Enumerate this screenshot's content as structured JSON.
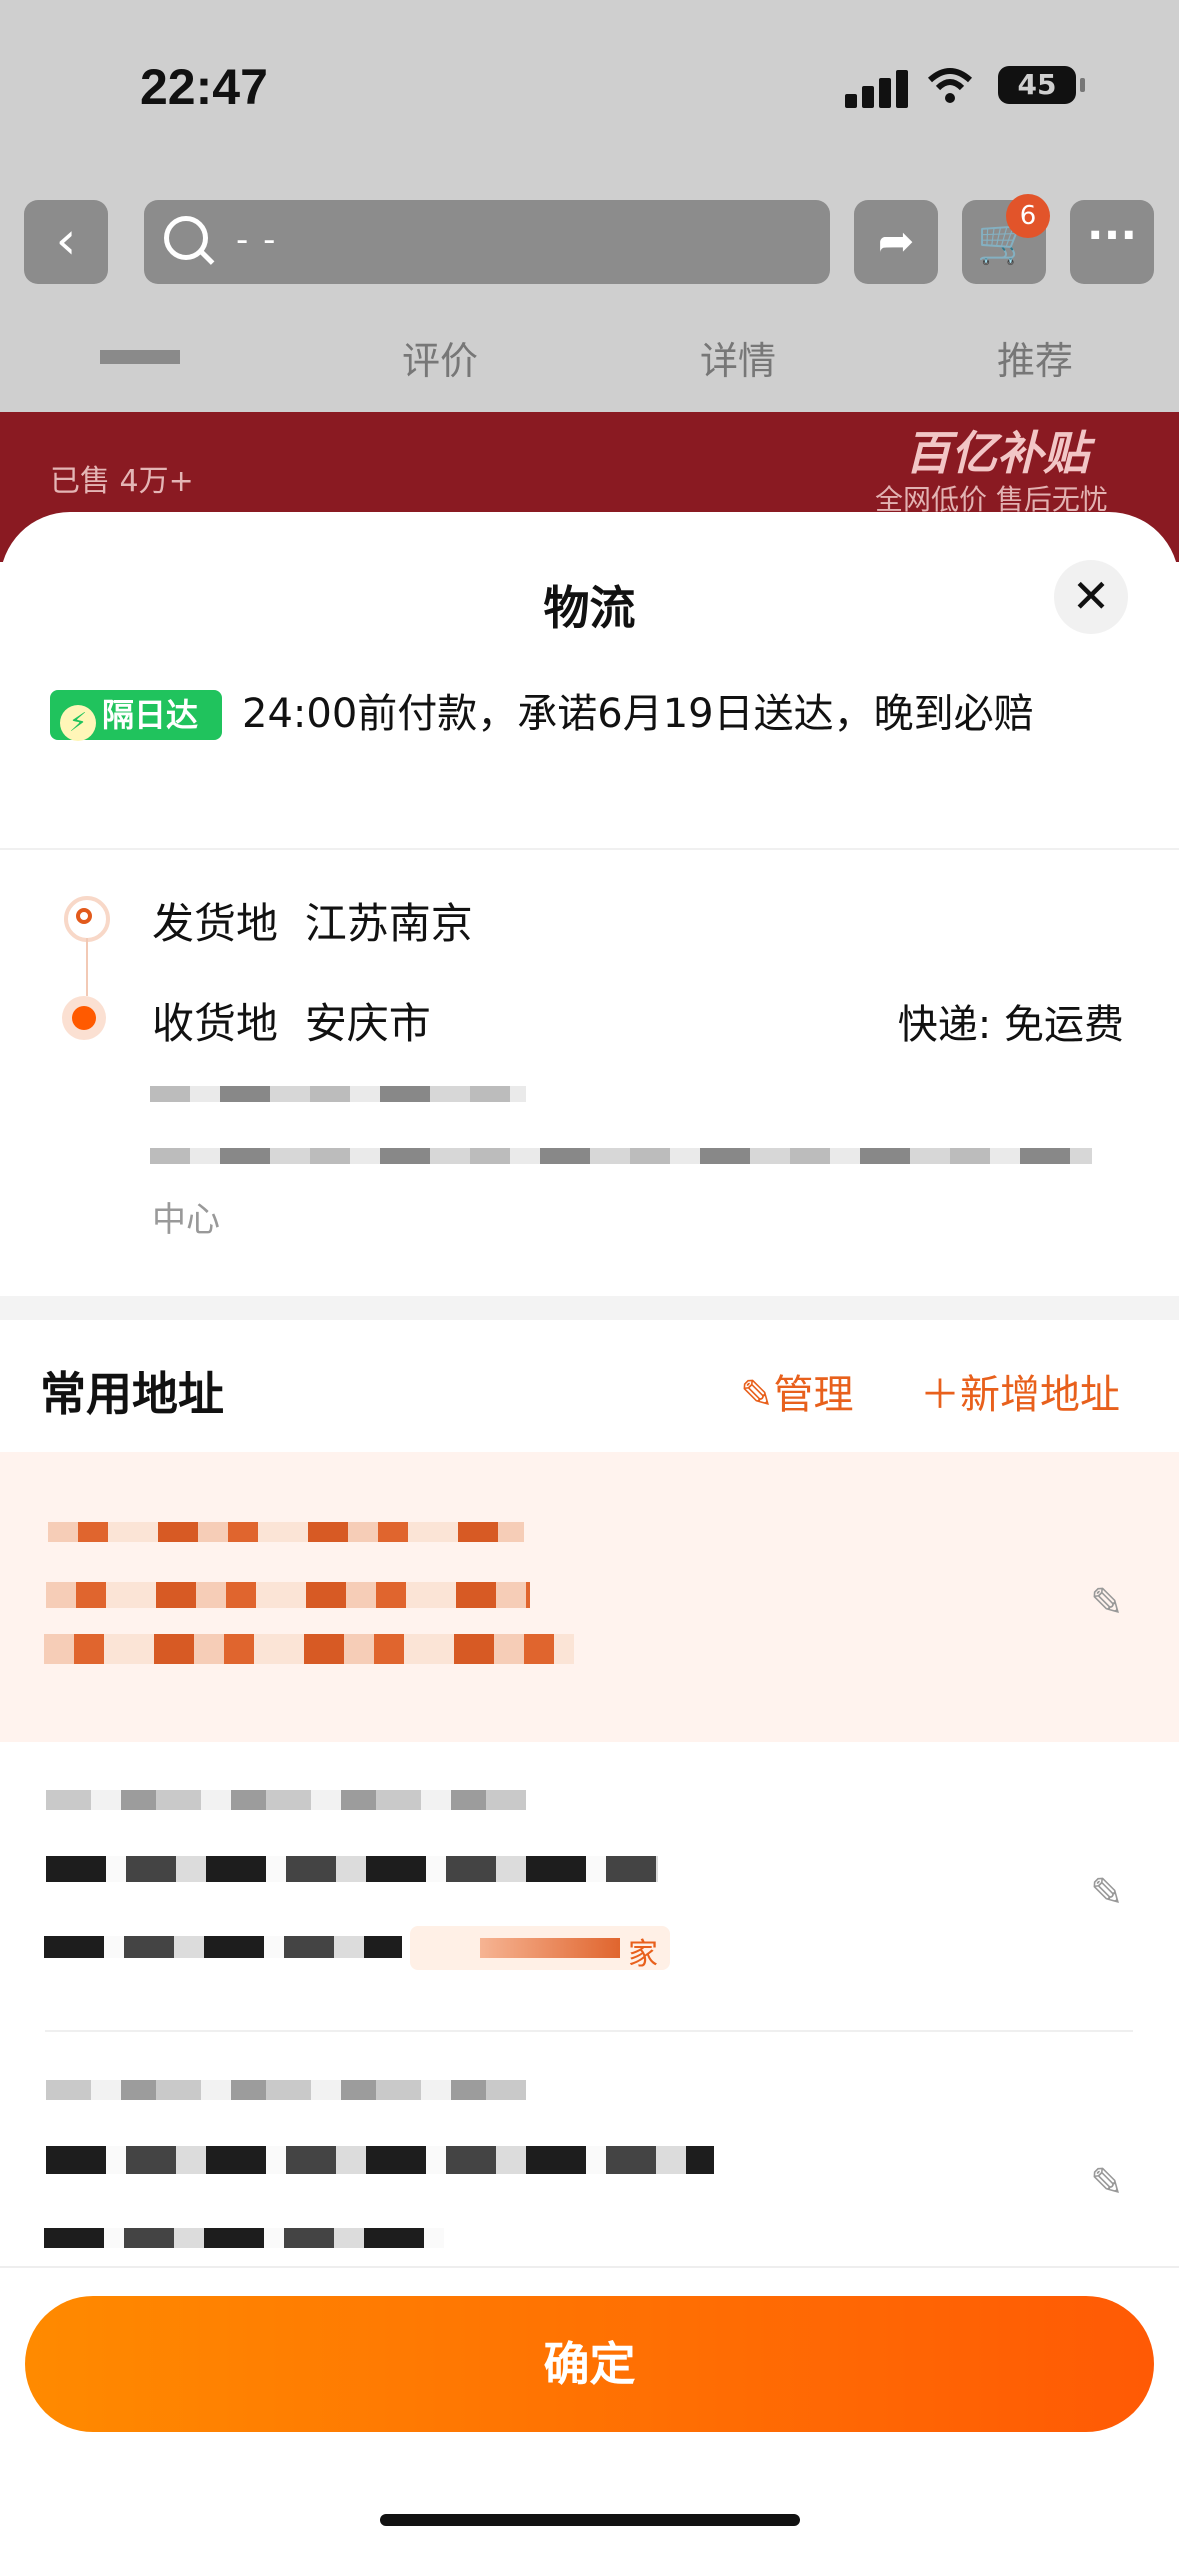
{
  "status": {
    "time": "22:47",
    "battery": "45"
  },
  "topbar": {
    "search_text": "- -",
    "cart_count": "6"
  },
  "tabs": [
    "评价",
    "详情",
    "推荐"
  ],
  "banner": {
    "sold": "已售 4万+",
    "brand": "百亿补贴",
    "sub": "全网低价 售后无忧"
  },
  "sheet": {
    "title": "物流",
    "delivery_tag": "隔日达",
    "delivery_text": "24:00前付款，承诺6月19日送达，晚到必赔",
    "from_label": "发货地",
    "from_value": "江苏南京",
    "to_label": "收货地",
    "to_value": "安庆市",
    "express": "快递: 免运费",
    "address_tail": "中心"
  },
  "common": {
    "title": "常用地址",
    "manage": "管理",
    "add": "新增地址"
  },
  "addresses": [
    {
      "selected": true
    },
    {
      "selected": false,
      "tag": "家"
    },
    {
      "selected": false
    }
  ],
  "confirm_label": "确定",
  "colors": {
    "accent": "#ff5a05",
    "accent_text": "#e8601c",
    "green_tag": "#20c35d"
  }
}
